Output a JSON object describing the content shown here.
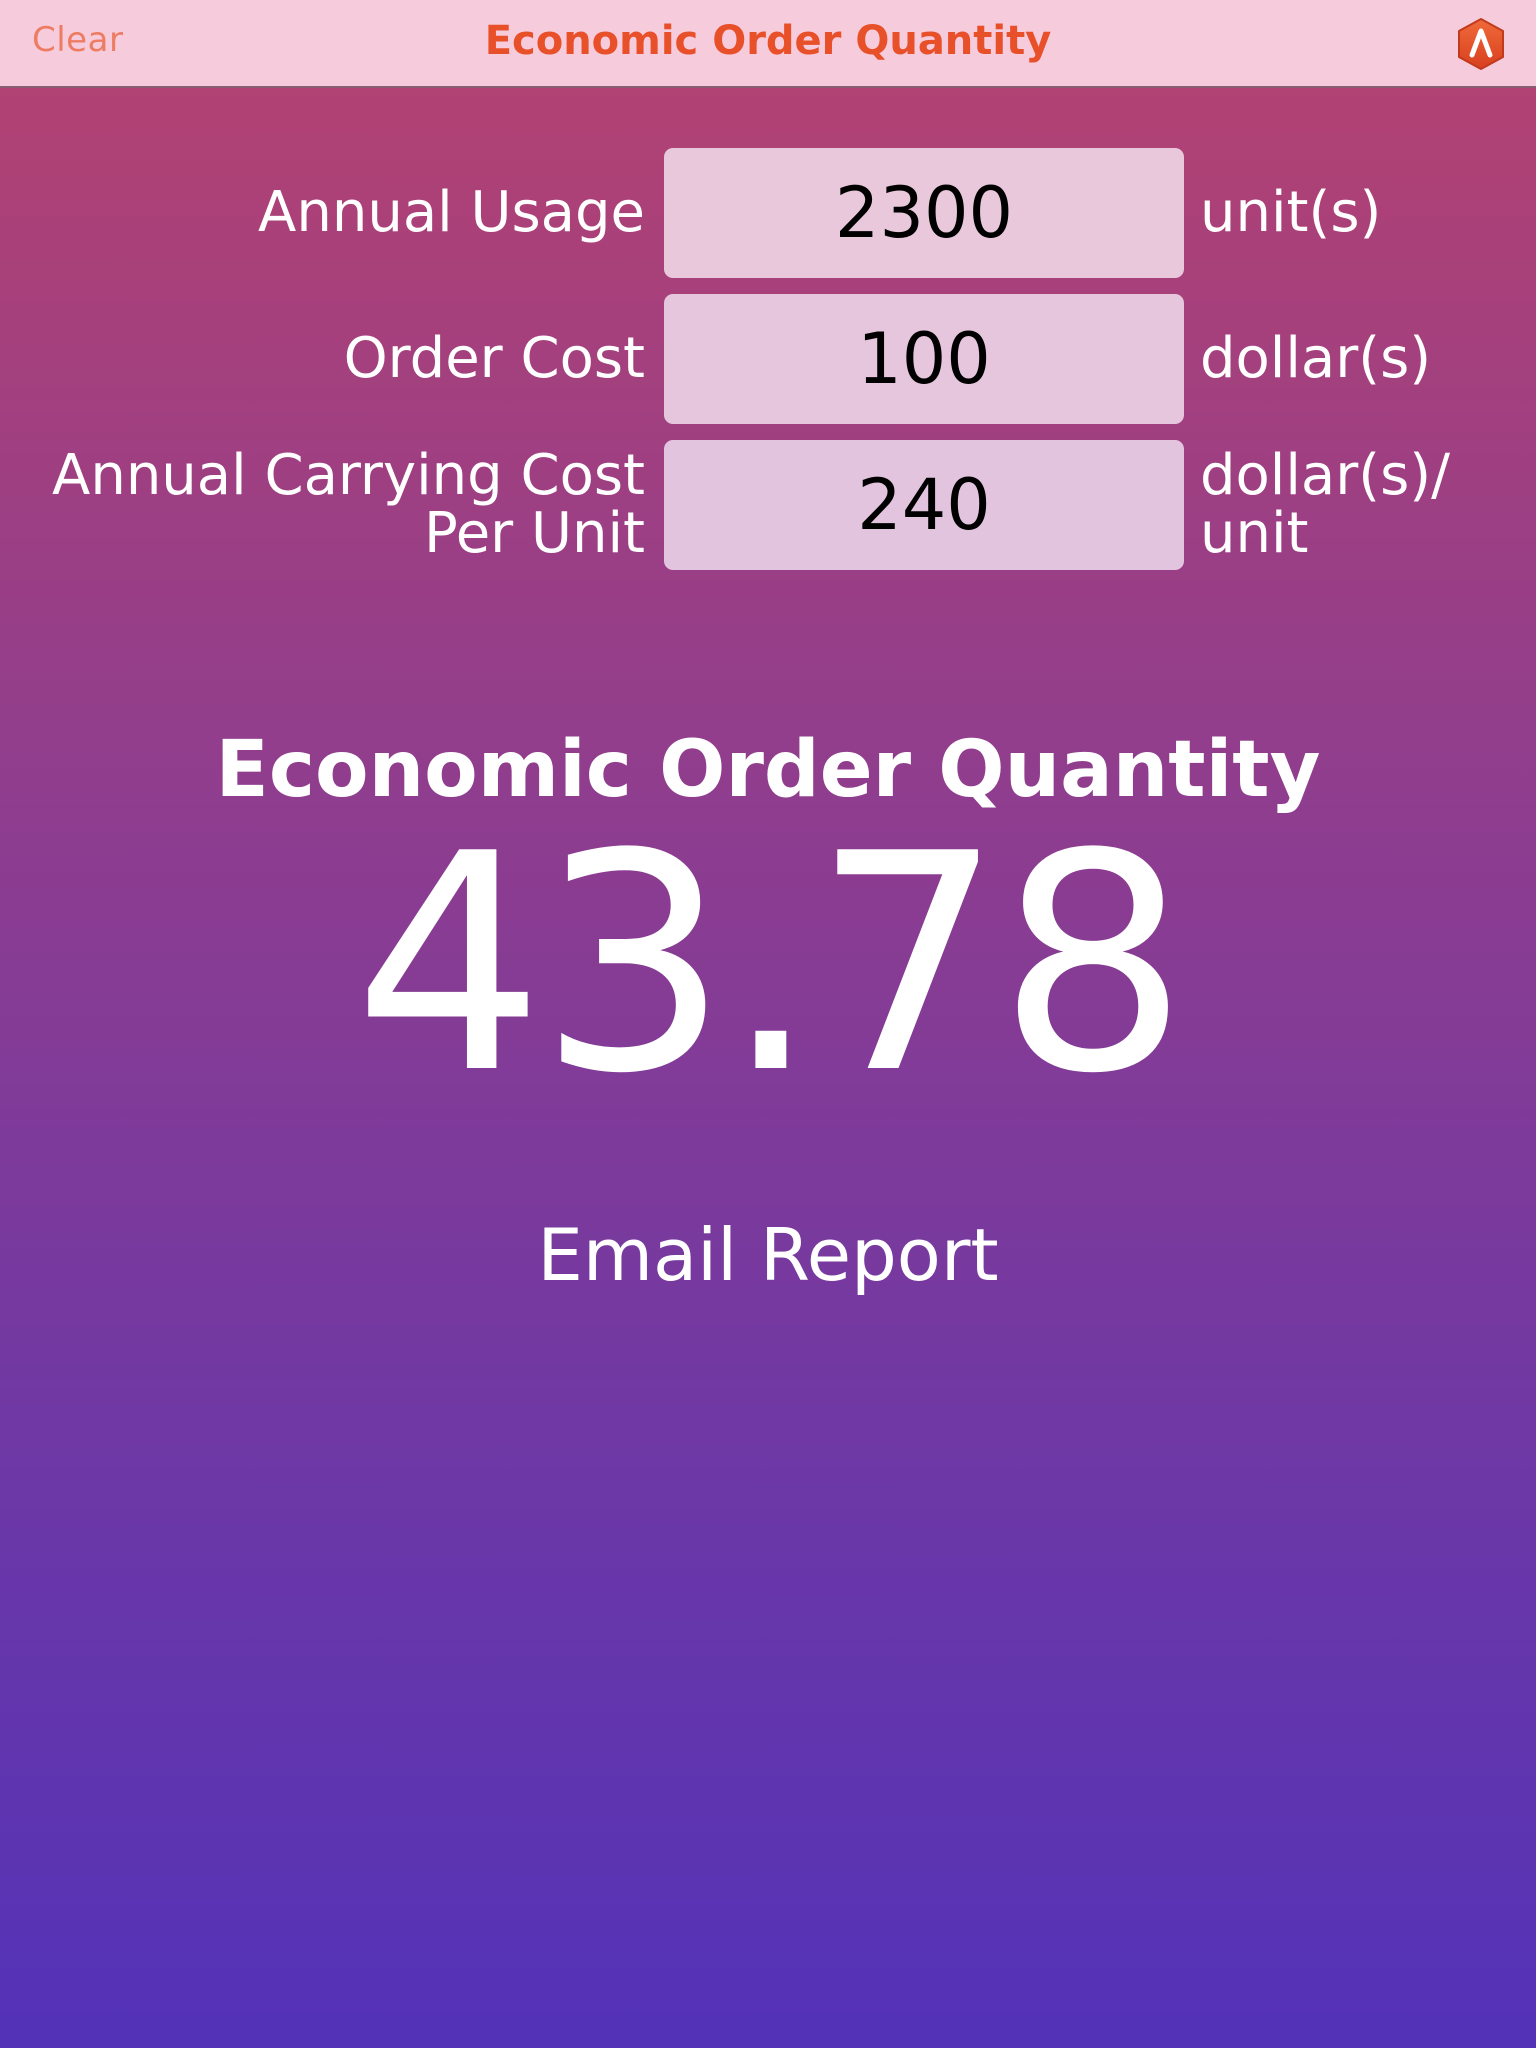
{
  "navbar": {
    "clear_label": "Clear",
    "title": "Economic Order Quantity",
    "logo_icon": "hexagon-caret-logo-icon",
    "title_color": "#e8502a"
  },
  "inputs": [
    {
      "label": "Annual Usage",
      "value": "2300",
      "unit": "unit(s)"
    },
    {
      "label": "Order Cost",
      "value": "100",
      "unit": "dollar(s)"
    },
    {
      "label_line1": "Annual Carrying Cost",
      "label_line2": "Per Unit",
      "value": "240",
      "unit_line1": "dollar(s)/",
      "unit_line2": "unit"
    }
  ],
  "result": {
    "heading": "Economic Order Quantity",
    "value": "43.78"
  },
  "actions": {
    "email_label": "Email Report"
  }
}
